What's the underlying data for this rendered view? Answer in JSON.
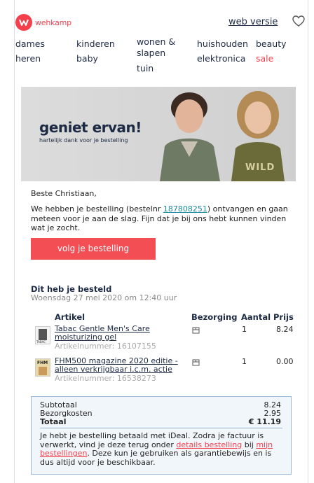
{
  "header": {
    "logo_text": "wehkamp",
    "web_versie": "web versie",
    "brand_color": "#f43f4d"
  },
  "nav": {
    "items": [
      "dames",
      "heren",
      "kinderen",
      "baby",
      "wonen &",
      "slapen",
      "tuin",
      "huishouden",
      "elektronica",
      "beauty",
      "sale"
    ]
  },
  "hero": {
    "title": "geniet ervan!",
    "subtitle": "hartelijk dank voor je bestelling",
    "shirt_text": "WILD"
  },
  "greeting": "Beste Christiaan,",
  "intro": {
    "before": "We hebben je bestelling (bestelnr ",
    "order_number": "187808251",
    "after": ") ontvangen en gaan meteen voor je aan de slag. Fijn dat je bij ons hebt kunnen vinden wat je zocht."
  },
  "button_label": "volg je bestelling",
  "order": {
    "title": "Dit heb je besteld",
    "date": "Woensdag 27 mei 2020 om 12:40 uur",
    "headers": {
      "artikel": "Artikel",
      "bezorging": "Bezorging",
      "aantal": "Aantal",
      "prijs": "Prijs"
    },
    "items": [
      {
        "name": "Tabac Gentle Men's Care moisturizing gel",
        "art": "Artikelnummer: 16107155",
        "qty": "1",
        "price": "8.24",
        "thumb": "TABAC"
      },
      {
        "name": "FHM500 magazine 2020 editie - alleen verkrijgbaar i.c.m. actie",
        "art": "Artikelnummer: 16538273",
        "qty": "1",
        "price": "0.00",
        "thumb": "FHM"
      }
    ]
  },
  "summary": {
    "subtotaal_label": "Subtotaal",
    "subtotaal": "8.24",
    "bezorg_label": "Bezorgkosten",
    "bezorg": "2.95",
    "totaal_label": "Totaal",
    "totaal": "€ 11.19",
    "note_1": "Je hebt je bestelling betaald met iDeal. Zodra je factuur is verwerkt, vind je deze terug onder ",
    "link_details": "details bestelling",
    "note_2": " bij ",
    "link_mijn": "mijn bestellingen",
    "note_3": ". Deze kun je gebruiken als garantiebewijs en is dus altijd voor je beschikbaar."
  }
}
